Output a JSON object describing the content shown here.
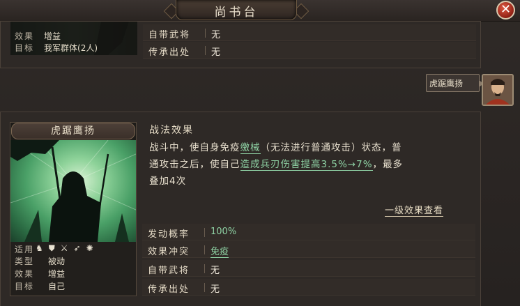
{
  "window": {
    "title": "尚书台",
    "close_symbol": "✕"
  },
  "top_panel": {
    "info": [
      {
        "key": "效果",
        "value": "增益"
      },
      {
        "key": "目标",
        "value": "我军群体(2人)"
      }
    ],
    "fields": [
      {
        "key": "自带武将",
        "value": "无"
      },
      {
        "key": "传承出处",
        "value": "无"
      }
    ]
  },
  "hero": {
    "skill_name": "虎踞鹰扬"
  },
  "skill_card": {
    "title": "虎踞鹰扬",
    "suitable_label": "适用",
    "suitable_icons": [
      "horse-icon",
      "shield-icon",
      "crossed-swords-icon",
      "arrow-icon",
      "wheel-icon"
    ],
    "info": [
      {
        "key": "类型",
        "value": "被动"
      },
      {
        "key": "效果",
        "value": "增益"
      },
      {
        "key": "目标",
        "value": "自己"
      }
    ]
  },
  "effect": {
    "title": "战法效果",
    "line1_a": "战斗中，使自身免疫",
    "line1_hl": "缴械",
    "line1_b": "（无法进行普通攻击）状态，普",
    "line2_a": "通攻击之后，使自己",
    "line2_hl": "造成兵刃伤害提高3.5%→7%",
    "line2_b": "，最多",
    "line3": "叠加4次",
    "link": "一级效果查看"
  },
  "fields": [
    {
      "key": "发动概率",
      "value": "100%"
    },
    {
      "key": "效果冲突",
      "value": "免疫"
    },
    {
      "key": "自带武将",
      "value": "无"
    },
    {
      "key": "传承出处",
      "value": "无"
    }
  ]
}
